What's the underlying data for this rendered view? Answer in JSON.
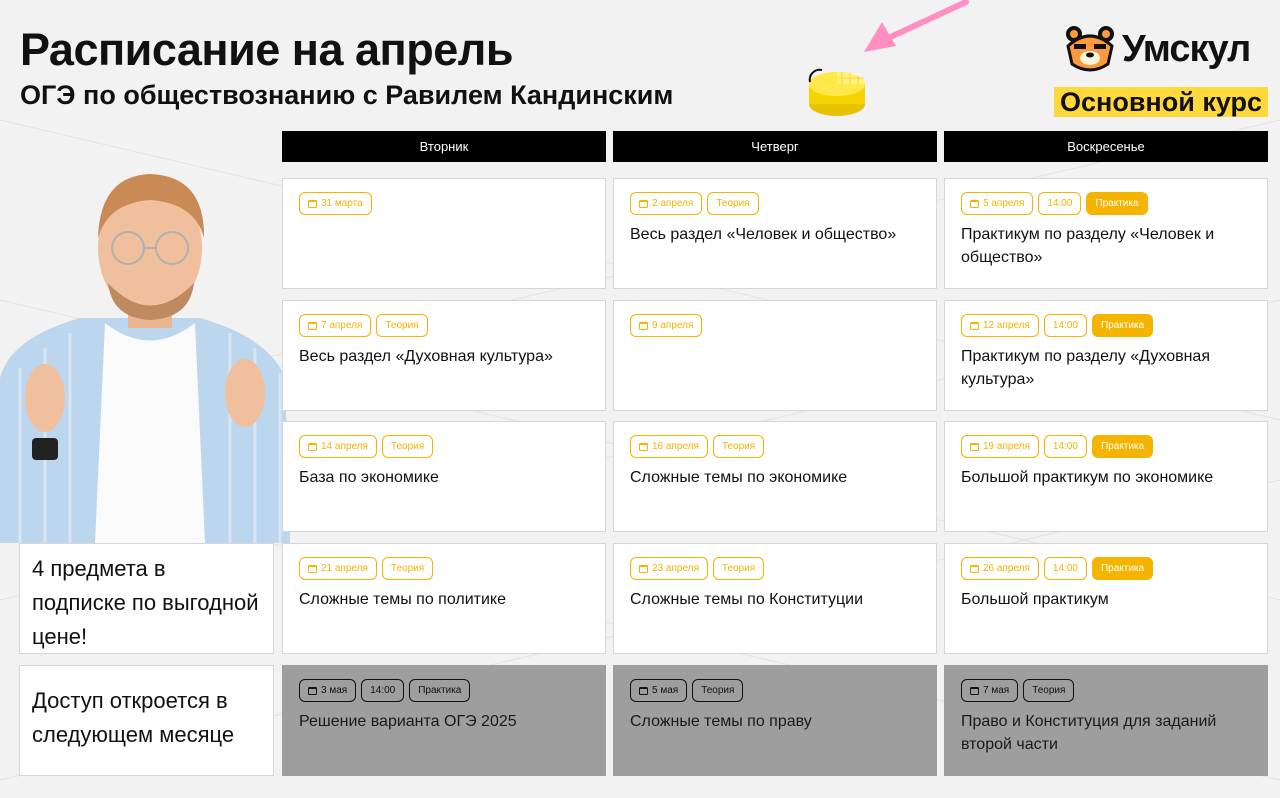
{
  "header": {
    "title": "Расписание на апрель",
    "subtitle": "ОГЭ по обществознанию с Равилем Кандинским",
    "brand": "Умскул",
    "course": "Основной курс"
  },
  "days": [
    "Вторник",
    "Четверг",
    "Воскресенье"
  ],
  "rows": [
    [
      {
        "tags": [
          {
            "text": "31 марта",
            "cal": true
          }
        ],
        "title": ""
      },
      {
        "tags": [
          {
            "text": "2 апреля",
            "cal": true
          },
          {
            "text": "Теория"
          }
        ],
        "title": "Весь раздел «Человек и общество»"
      },
      {
        "tags": [
          {
            "text": "5 апреля",
            "cal": true
          },
          {
            "text": "14:00"
          },
          {
            "text": "Практика",
            "fill": true
          }
        ],
        "title": "Практикум по разделу «Человек и общество»"
      }
    ],
    [
      {
        "tags": [
          {
            "text": "7 апреля",
            "cal": true
          },
          {
            "text": "Теория"
          }
        ],
        "title": "Весь раздел «Духовная культура»"
      },
      {
        "tags": [
          {
            "text": "9 апреля",
            "cal": true
          }
        ],
        "title": ""
      },
      {
        "tags": [
          {
            "text": "12 апреля",
            "cal": true
          },
          {
            "text": "14:00"
          },
          {
            "text": "Практика",
            "fill": true
          }
        ],
        "title": "Практикум по разделу «Духовная культура»"
      }
    ],
    [
      {
        "tags": [
          {
            "text": "14 апреля",
            "cal": true
          },
          {
            "text": "Теория"
          }
        ],
        "title": "База по экономике"
      },
      {
        "tags": [
          {
            "text": "16 апреля",
            "cal": true
          },
          {
            "text": "Теория"
          }
        ],
        "title": "Сложные темы по экономике"
      },
      {
        "tags": [
          {
            "text": "19 апреля",
            "cal": true
          },
          {
            "text": "14:00"
          },
          {
            "text": "Практика",
            "fill": true
          }
        ],
        "title": "Большой практикум по экономике"
      }
    ],
    [
      {
        "tags": [
          {
            "text": "21 апреля",
            "cal": true
          },
          {
            "text": "Теория"
          }
        ],
        "title": "Сложные темы по политике"
      },
      {
        "tags": [
          {
            "text": "23 апреля",
            "cal": true
          },
          {
            "text": "Теория"
          }
        ],
        "title": "Сложные темы по Конституции"
      },
      {
        "tags": [
          {
            "text": "26 апреля",
            "cal": true
          },
          {
            "text": "14:00"
          },
          {
            "text": "Практика",
            "fill": true
          }
        ],
        "title": "Большой практикум"
      }
    ],
    [
      {
        "locked": true,
        "tags": [
          {
            "text": "3 мая",
            "cal": true
          },
          {
            "text": "14:00"
          },
          {
            "text": "Практика"
          }
        ],
        "title": "Решение варианта ОГЭ 2025"
      },
      {
        "locked": true,
        "tags": [
          {
            "text": "5 мая",
            "cal": true
          },
          {
            "text": "Теория"
          }
        ],
        "title": "Сложные темы по праву"
      },
      {
        "locked": true,
        "tags": [
          {
            "text": "7 мая",
            "cal": true
          },
          {
            "text": "Теория"
          }
        ],
        "title": "Право и Конституция для заданий второй части"
      }
    ]
  ],
  "promo": "4 предмета в подписке по выгодной цене!",
  "next_month": "Доступ откроется в следующем месяце",
  "colors": {
    "accent": "#f5b400",
    "brand_yellow": "#ffd93b",
    "arrow": "#ff8fc0",
    "locked": "#9e9e9e"
  }
}
